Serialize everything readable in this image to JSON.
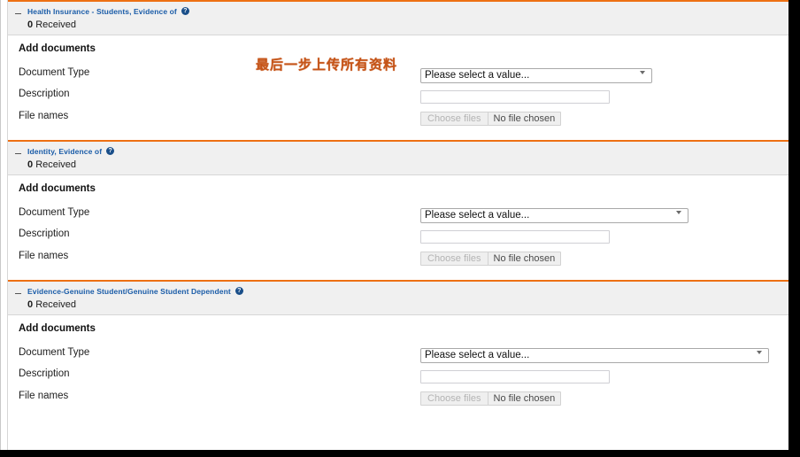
{
  "annotation": {
    "text": "最后一步上传所有资料",
    "color": "#c55418"
  },
  "theme": {
    "divider_orange": "#ed7013",
    "title_blue": "#1a5ca8",
    "header_bg": "#f0f0f0"
  },
  "common": {
    "collapse_icon": "minus-collapse-icon",
    "help_icon": "help-question-icon",
    "help_glyph": "?",
    "received_count": "0",
    "received_label": "Received",
    "add_documents_heading": "Add documents",
    "labels": {
      "document_type": "Document Type",
      "description": "Description",
      "file_names": "File names"
    },
    "select_placeholder": "Please select a value...",
    "description_value": "",
    "description_placeholder": "",
    "file_button_label": "Choose files",
    "file_status_text": "No file chosen"
  },
  "sections": [
    {
      "id": "health-insurance-students",
      "title": "Health Insurance - Students, Evidence of",
      "received_count": "0",
      "received_label": "Received",
      "select_value": "Please select a value...",
      "select_width": 262,
      "description_width": 214,
      "file_width": 200
    },
    {
      "id": "identity-evidence-of",
      "title": "Identity, Evidence of",
      "received_count": "0",
      "received_label": "Received",
      "select_value": "Please select a value...",
      "select_width": 303,
      "description_width": 214,
      "file_width": 200
    },
    {
      "id": "evidence-genuine-student",
      "title": "Evidence-Genuine Student/Genuine Student Dependent",
      "received_count": "0",
      "received_label": "Received",
      "select_value": "Please select a value...",
      "select_width": 394,
      "description_width": 214,
      "file_width": 200
    }
  ]
}
